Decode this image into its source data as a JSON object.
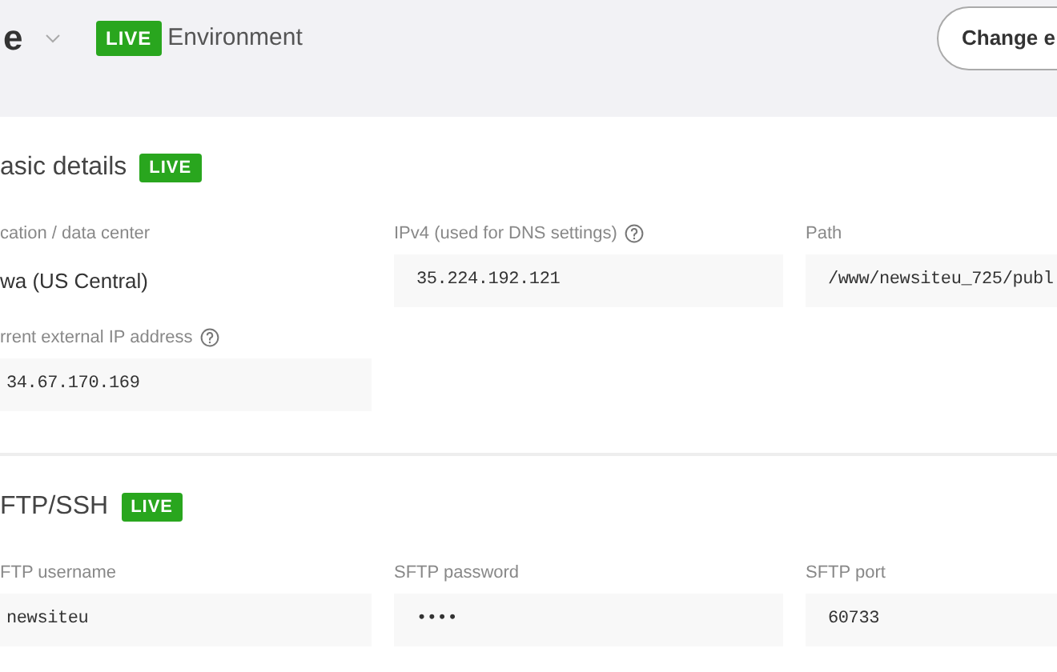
{
  "header": {
    "site_name": "e",
    "badge": "LIVE",
    "environment": "Environment",
    "button": "Change e"
  },
  "sections": [
    {
      "title": "asic details",
      "badge": "LIVE",
      "fields": [
        {
          "label": "cation / data center",
          "value": "wa (US Central)",
          "kind": "plain",
          "help": false
        },
        {
          "label": "IPv4 (used for DNS settings)",
          "value": "35.224.192.121",
          "kind": "box",
          "help": true
        },
        {
          "label": "Path",
          "value": "/www/newsiteu_725/publ",
          "kind": "box",
          "help": false
        },
        {
          "label": "rrent external IP address",
          "value": "34.67.170.169",
          "kind": "box",
          "help": true
        }
      ]
    },
    {
      "title": "FTP/SSH",
      "badge": "LIVE",
      "fields": [
        {
          "label": "FTP username",
          "value": "newsiteu",
          "kind": "box",
          "help": false
        },
        {
          "label": "SFTP password",
          "value": "••••",
          "kind": "box",
          "help": false
        },
        {
          "label": "SFTP port",
          "value": "60733",
          "kind": "box",
          "help": false
        }
      ]
    }
  ]
}
